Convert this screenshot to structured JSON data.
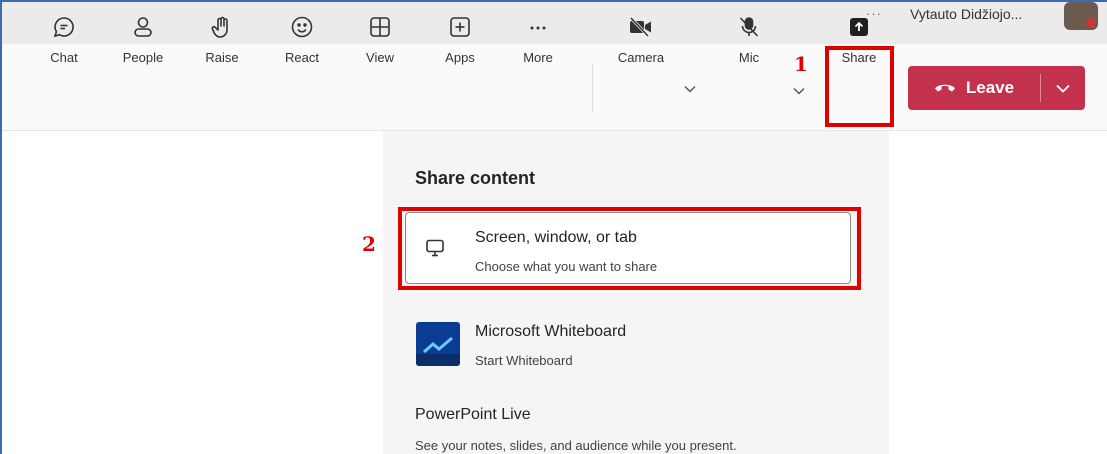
{
  "topbar": {
    "more_dots": "···",
    "org_name": "Vytauto Didžiojo..."
  },
  "toolbar": {
    "chat": "Chat",
    "people": "People",
    "raise": "Raise",
    "react": "React",
    "view": "View",
    "apps": "Apps",
    "more": "More",
    "camera": "Camera",
    "mic": "Mic",
    "share": "Share",
    "leave": "Leave",
    "more_glyph": "···"
  },
  "annotations": {
    "step1": "1",
    "step2": "2"
  },
  "share_panel": {
    "title": "Share content",
    "options": [
      {
        "title": "Screen, window, or tab",
        "subtitle": "Choose what you want to share"
      },
      {
        "title": "Microsoft Whiteboard",
        "subtitle": "Start Whiteboard"
      }
    ],
    "powerpoint": {
      "title": "PowerPoint Live",
      "subtitle": "See your notes, slides, and audience while you present."
    }
  },
  "colors": {
    "leave_red": "#c4314b",
    "annotation_red": "#e00000",
    "whiteboard_blue": "#0a3d91"
  }
}
